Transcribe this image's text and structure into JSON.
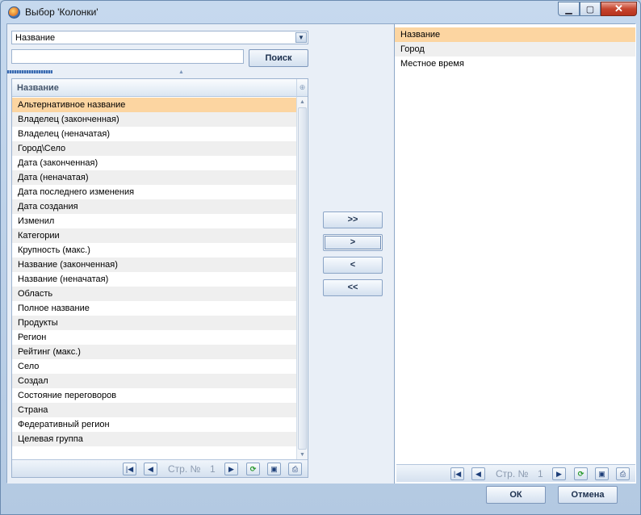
{
  "window": {
    "title": "Выбор 'Колонки'"
  },
  "left": {
    "field_select": "Название",
    "search_value": "",
    "search_button": "Поиск",
    "column_header": "Название",
    "rows": [
      "Альтернативное название",
      "Владелец (законченная)",
      "Владелец (неначатая)",
      "Город\\Село",
      "Дата (законченная)",
      "Дата (неначатая)",
      "Дата последнего изменения",
      "Дата создания",
      "Изменил",
      "Категории",
      "Крупность (макс.)",
      "Название (законченная)",
      "Название (неначатая)",
      "Область",
      "Полное название",
      "Продукты",
      "Регион",
      "Рейтинг (макс.)",
      "Село",
      "Создал",
      "Состояние переговоров",
      "Страна",
      "Федеративный регион",
      "Целевая группа"
    ],
    "selected_row": "Альтернативное название",
    "pager": {
      "label": "Стр. №",
      "page": "1"
    }
  },
  "middle": {
    "add_all": ">>",
    "add": ">",
    "remove": "<",
    "remove_all": "<<"
  },
  "right": {
    "rows": [
      "Название",
      "Город",
      "Местное время"
    ],
    "selected_row": "Название",
    "pager": {
      "label": "Стр. №",
      "page": "1"
    }
  },
  "footer": {
    "ok": "ОК",
    "cancel": "Отмена"
  },
  "icons": {
    "first": "first-page-icon",
    "prev": "prev-page-icon",
    "next": "next-page-icon",
    "refresh": "refresh-icon",
    "save": "save-icon",
    "print": "print-icon"
  },
  "colors": {
    "selection": "#fcd5a1",
    "pane_bg": "#e9eff7"
  }
}
